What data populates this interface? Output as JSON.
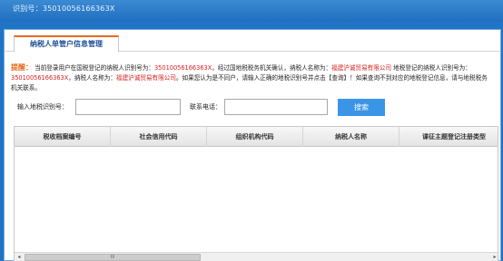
{
  "header": {
    "taxid_label": "识别号：",
    "taxid_value": "35010056166363X"
  },
  "tab": {
    "label": "纳税人单管户信息管理"
  },
  "notice": {
    "label": "提醒：",
    "p1": "当前登录用户在国税登记的纳税人识别号为：",
    "id1": "35010056166363X",
    "p2": "，经过国地税税务机关确认，纳税人名称为：",
    "name1": "福建沪诚贸易有限公司",
    "p3": " 地税登记的纳税人识别号为：",
    "id2": "35010056166363X",
    "p4": "，纳税人名称为：",
    "name2": "福建沪诚贸易有限公司",
    "p5": "。如果您认为是不同户，请输入正确的地税识别号并点击【查询】！如果查询不到对应的地税登记信息，请与地税税务机关联系。"
  },
  "form": {
    "taxid_label": "输入地税识别号：",
    "taxid_value": "",
    "phone_label": "联系电话：",
    "phone_value": "",
    "search_label": "搜索"
  },
  "table": {
    "columns": [
      "税收档案编号",
      "社会信用代码",
      "组织机构代码",
      "纳税人名称",
      "课征主题登记注册类型"
    ]
  },
  "scrollbar": {
    "left_arrow": "◂",
    "right_arrow": "▸",
    "grip": "III"
  },
  "colors": {
    "page_bg": "#1f74c5",
    "tab_accent": "#e86a1a",
    "highlight_red": "#d81e1e",
    "search_button": "#3b95e6"
  }
}
